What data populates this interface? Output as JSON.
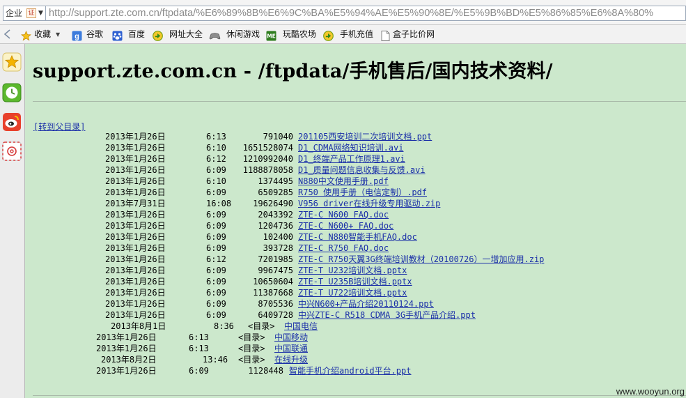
{
  "browser": {
    "zone_label": "企业",
    "zone_icon": "证",
    "url": "http://support.zte.com.cn/ftpdata/%E6%89%8B%E6%9C%BA%E5%94%AE%E5%90%8E/%E5%9B%BD%E5%86%85%E6%8A%80%"
  },
  "bookmarks": [
    {
      "label": "收藏",
      "icon": "star-icon"
    },
    {
      "label": "谷歌",
      "icon": "google-icon"
    },
    {
      "label": "百度",
      "icon": "baidu-paw-icon"
    },
    {
      "label": "网址大全",
      "icon": "green-circle-icon"
    },
    {
      "label": "休闲游戏",
      "icon": "gamepad-icon"
    },
    {
      "label": "玩酷农场",
      "icon": "farm-icon"
    },
    {
      "label": "手机充值",
      "icon": "green-circle-icon"
    },
    {
      "label": "盒子比价网",
      "icon": "page-icon"
    }
  ],
  "sidepanel": [
    "favorites-star-icon",
    "history-clock-icon",
    "weibo-icon",
    "mail-icon"
  ],
  "page": {
    "title": "support.zte.com.cn - /ftpdata/手机售后/国内技术资料/",
    "parent_link": "[转到父目录]",
    "dir_tag": "<目录>",
    "files_a": [
      {
        "date": "2013年1月26日",
        "time": "6:13",
        "size": "791040",
        "name": "201105西安培训二次培训文档.ppt"
      },
      {
        "date": "2013年1月26日",
        "time": "6:10",
        "size": "1651528074",
        "name": "D1_CDMA网络知识培训.avi"
      },
      {
        "date": "2013年1月26日",
        "time": "6:12",
        "size": "1210992040",
        "name": "D1_终端产品工作原理1.avi"
      },
      {
        "date": "2013年1月26日",
        "time": "6:09",
        "size": "1188878058",
        "name": "D1_质量问题信息收集与反馈.avi"
      },
      {
        "date": "2013年1月26日",
        "time": "6:10",
        "size": "1374495",
        "name": "N880中文使用手册.pdf"
      },
      {
        "date": "2013年1月26日",
        "time": "6:09",
        "size": "6509285",
        "name": "R750 使用手册（电信定制）.pdf"
      },
      {
        "date": "2013年7月31日",
        "time": "16:08",
        "size": "19626490",
        "name": "V956 driver在线升级专用驱动.zip"
      },
      {
        "date": "2013年1月26日",
        "time": "6:09",
        "size": "2043392",
        "name": "ZTE-C N600 FAQ.doc"
      },
      {
        "date": "2013年1月26日",
        "time": "6:09",
        "size": "1204736",
        "name": "ZTE-C N600+ FAQ.doc"
      },
      {
        "date": "2013年1月26日",
        "time": "6:09",
        "size": "102400",
        "name": "ZTE-C N880智能手机FAQ.doc"
      },
      {
        "date": "2013年1月26日",
        "time": "6:09",
        "size": "393728",
        "name": "ZTE-C R750 FAQ.doc"
      },
      {
        "date": "2013年1月26日",
        "time": "6:12",
        "size": "7201985",
        "name": "ZTE-C R750天翼3G终端培训教材（20100726）一增加应用.zip"
      },
      {
        "date": "2013年1月26日",
        "time": "6:09",
        "size": "9967475",
        "name": "ZTE-T U232培训文档.pptx"
      },
      {
        "date": "2013年1月26日",
        "time": "6:09",
        "size": "10650604",
        "name": "ZTE-T U235B培训文档.pptx"
      },
      {
        "date": "2013年1月26日",
        "time": "6:09",
        "size": "11387668",
        "name": "ZTE-T U722培训文档.pptx"
      },
      {
        "date": "2013年1月26日",
        "time": "6:09",
        "size": "8705536",
        "name": "中兴N600+产品介绍20110124.ppt"
      },
      {
        "date": "2013年1月26日",
        "time": "6:09",
        "size": "6409728",
        "name": "中兴ZTE-C R518 CDMA 3G手机产品介绍.ppt"
      }
    ],
    "dir_rows": [
      {
        "date": "2013年8月1日",
        "time": "8:36",
        "name": "中国电信"
      },
      {
        "date": "2013年1月26日",
        "time": "6:13",
        "name": "中国移动"
      },
      {
        "date": "2013年1月26日",
        "time": "6:13",
        "name": "中国联通"
      },
      {
        "date": "2013年8月2日",
        "time": "13:46",
        "name": "在线升级"
      }
    ],
    "last_file": {
      "date": "2013年1月26日",
      "time": "6:09",
      "size": "1128448",
      "name": "智能手机介绍android平台.ppt"
    }
  },
  "watermark": "www.wooyun.org"
}
